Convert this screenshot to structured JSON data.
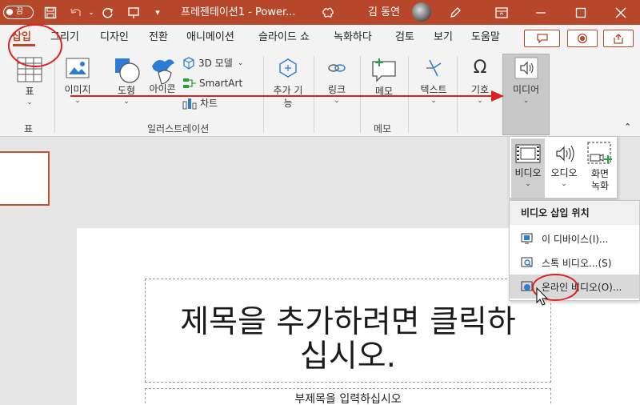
{
  "titlebar": {
    "autosave_label": "끔",
    "document_title": "프레젠테이션1 - Power...",
    "user_name": "김 동연"
  },
  "tabs": [
    "삽입",
    "그리기",
    "디자인",
    "전환",
    "애니메이션",
    "슬라이드 쇼",
    "녹화하다",
    "검토",
    "보기",
    "도움말"
  ],
  "ribbon": {
    "table": "표",
    "images": "이미지",
    "shapes": "도형",
    "icons": "아이콘",
    "models_3d": "3D 모델",
    "smartart": "SmartArt",
    "chart": "차트",
    "addins": "추가 기능",
    "link": "링크",
    "comment": "메모",
    "text": "텍스트",
    "symbols": "기호",
    "media": "미디어",
    "group_table": "표",
    "group_illustrations": "일러스트레이션",
    "group_comments": "메모"
  },
  "media_dropdown": {
    "video": "비디오",
    "audio": "오디오",
    "screen_recording_line1": "화면",
    "screen_recording_line2": "녹화"
  },
  "video_menu": {
    "header": "비디오 삽입 위치",
    "items": [
      "이 디바이스(I)...",
      "스톡 비디오...(S)",
      "온라인 비디오(O)..."
    ]
  },
  "slide": {
    "title_line1": "제목을 추가하려면 클릭하",
    "title_line2": "십시오.",
    "subtitle": "부제목을 입력하십시오"
  },
  "colors": {
    "accent": "#b7472a",
    "annotation_red": "#e02020"
  }
}
